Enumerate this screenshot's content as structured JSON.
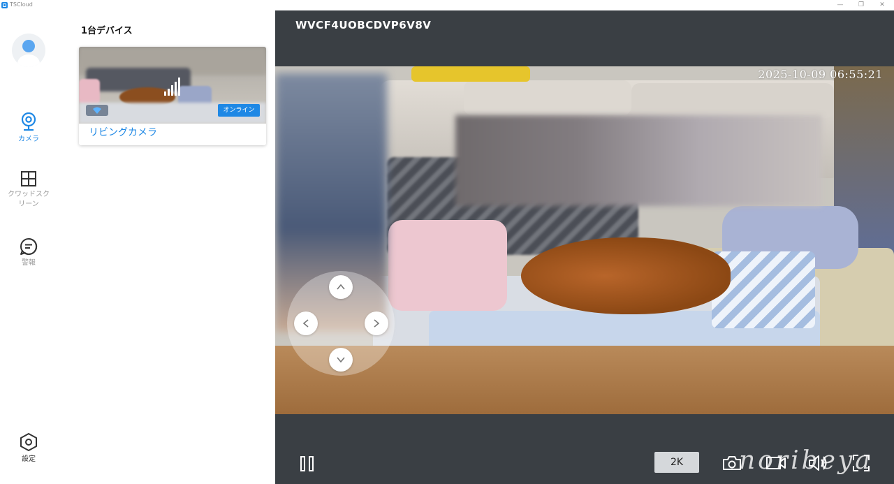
{
  "window": {
    "title": "TSCloud",
    "controls": {
      "minimize": "—",
      "restore": "❐",
      "close": "✕"
    }
  },
  "sidebar": {
    "items": [
      {
        "label": "カメラ",
        "icon": "camera-icon",
        "active": true
      },
      {
        "label": "クワッドスクリーン",
        "icon": "grid-icon",
        "active": false
      },
      {
        "label": "警報",
        "icon": "message-icon",
        "active": false
      },
      {
        "label": "設定",
        "icon": "settings-hex-icon",
        "active": false
      }
    ]
  },
  "devices": {
    "header": "1台デバイス",
    "list": [
      {
        "name": "リビングカメラ",
        "status": "オンライン",
        "wifi": true
      }
    ]
  },
  "player": {
    "device_id": "WVCF4UOBCDVP6V8V",
    "timestamp": "2025-10-09 06:55:21",
    "resolution": "2K",
    "watermark": "noribeya"
  },
  "colors": {
    "accent": "#1e88e5",
    "player_bg": "#3a3f44",
    "inactive_nav": "#999999"
  }
}
